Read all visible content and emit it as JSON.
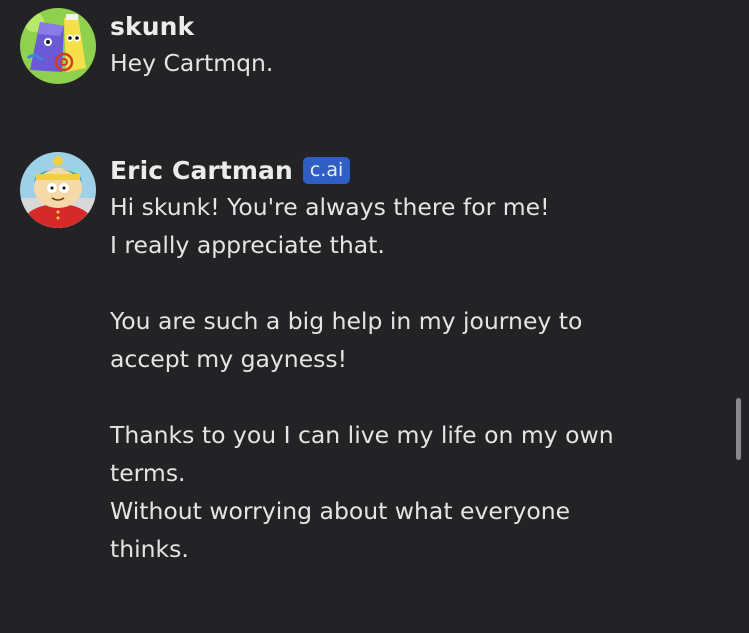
{
  "messages": [
    {
      "author": "skunk",
      "avatar_icon": "character-avatar-icon",
      "lines": [
        "Hey Cartmqn."
      ]
    },
    {
      "author": "Eric Cartman",
      "badge": "c.ai",
      "avatar_icon": "cartman-avatar-icon",
      "lines": [
        "Hi skunk! You're always there for me!",
        "I really appreciate that.",
        "",
        "You are such a big help in my journey to",
        "accept my gayness!",
        "",
        "Thanks to you I can live my life on my own",
        "terms.",
        "Without worrying about what everyone",
        "thinks."
      ]
    }
  ],
  "colors": {
    "background": "#232325",
    "text": "#e4e4e4",
    "badge": "#2f5fc4",
    "scrollbar": "#8a8a8c"
  }
}
